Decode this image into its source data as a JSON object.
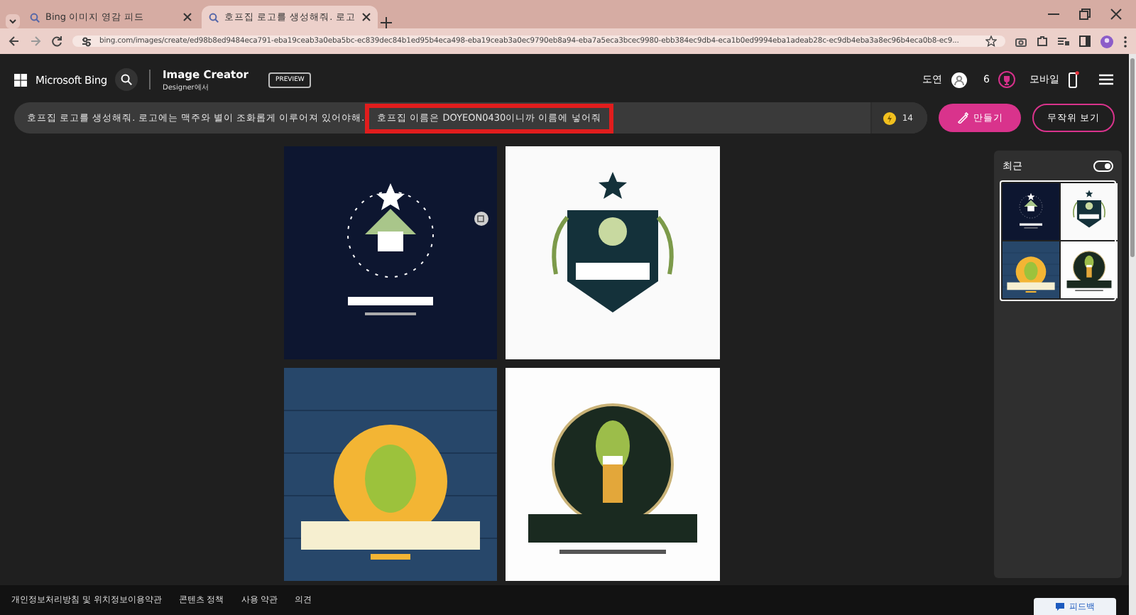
{
  "browser": {
    "tabs": [
      {
        "title": "Bing 이미지 영감 피드",
        "selected": false
      },
      {
        "title": "호프집 로고를 생성해줘. 로고",
        "selected": true
      }
    ],
    "url": "bing.com/images/create/ed98b8ed9484eca791-eba19ceab3a0eba5bc-ec839dec84b1ed95b4eca498-eba19ceab3a0ec9790eb8a94-eba7a5eca3bcec9980-ebb384ec9db4-eca1b0ed9994eba1adeab28c-ec9db4eba3a8ec96b4eca0b8-ec9..."
  },
  "header": {
    "brand": "Microsoft Bing",
    "product": "Image Creator",
    "subtitle": "Designer에서",
    "badge": "PREVIEW",
    "user": "도연",
    "points": "6",
    "mobile": "모바일"
  },
  "prompt": {
    "text": "호프집 로고를 생성해줘. 로고에는 맥주와 별이 조화롭게 이루어져 있어야해.",
    "highlighted": "호프집 이름은 DOYEON0430이니까 이름에 넣어줘",
    "boosts": "14"
  },
  "buttons": {
    "create": "만들기",
    "surprise": "무작위 보기"
  },
  "recent": {
    "title": "최근",
    "toggle_on": true
  },
  "footer": {
    "links": [
      "개인정보처리방침 및 위치정보이용약관",
      "콘텐츠 정책",
      "사용 약관",
      "의견"
    ],
    "feedback": "피드백"
  }
}
